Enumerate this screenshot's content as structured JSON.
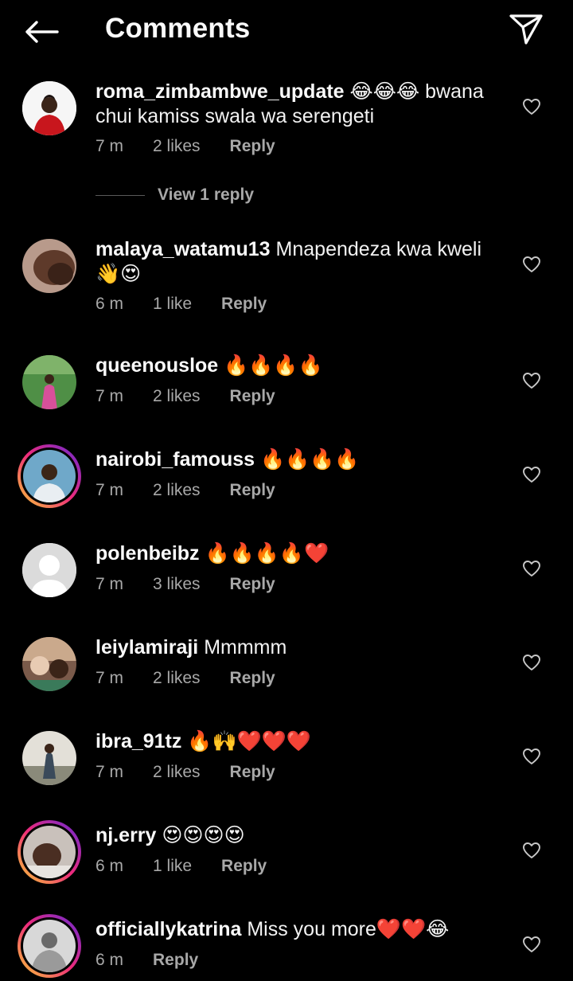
{
  "header": {
    "title": "Comments",
    "back_icon": "arrow-left-icon",
    "share_icon": "paper-plane-icon"
  },
  "colors": {
    "background": "#000000",
    "text_primary": "#f5f5f5",
    "text_secondary": "#a8a8a8",
    "story_ring": "#ee2a7b"
  },
  "comments": [
    {
      "username": "roma_zimbambwe_update",
      "text": "😂😂😂 bwana chui kamiss swala wa serengeti",
      "time": "7 m",
      "likes": "2 likes",
      "reply": "Reply",
      "view_replies": "View 1 reply",
      "story_ring": false
    },
    {
      "username": "malaya_watamu13",
      "text": "Mnapendeza kwa kweli 👋😍",
      "time": "6 m",
      "likes": "1 like",
      "reply": "Reply",
      "story_ring": false
    },
    {
      "username": "queenousloe",
      "text": "🔥🔥🔥🔥",
      "time": "7 m",
      "likes": "2 likes",
      "reply": "Reply",
      "story_ring": false
    },
    {
      "username": "nairobi_famouss",
      "text": "🔥🔥🔥🔥",
      "time": "7 m",
      "likes": "2 likes",
      "reply": "Reply",
      "story_ring": true
    },
    {
      "username": "polenbeibz",
      "text": "🔥🔥🔥🔥❤️",
      "time": "7 m",
      "likes": "3 likes",
      "reply": "Reply",
      "story_ring": false
    },
    {
      "username": "leiylamiraji",
      "text": "Mmmmm",
      "time": "7 m",
      "likes": "2 likes",
      "reply": "Reply",
      "story_ring": false
    },
    {
      "username": "ibra_91tz",
      "text": "🔥🙌❤️❤️❤️",
      "time": "7 m",
      "likes": "2 likes",
      "reply": "Reply",
      "story_ring": false
    },
    {
      "username": "nj.erry",
      "text": "😍😍😍😍",
      "time": "6 m",
      "likes": "1 like",
      "reply": "Reply",
      "story_ring": true
    },
    {
      "username": "officiallykatrina",
      "text": "Miss you more❤️❤️😂",
      "time": "6 m",
      "likes": "",
      "reply": "Reply",
      "story_ring": true
    }
  ]
}
